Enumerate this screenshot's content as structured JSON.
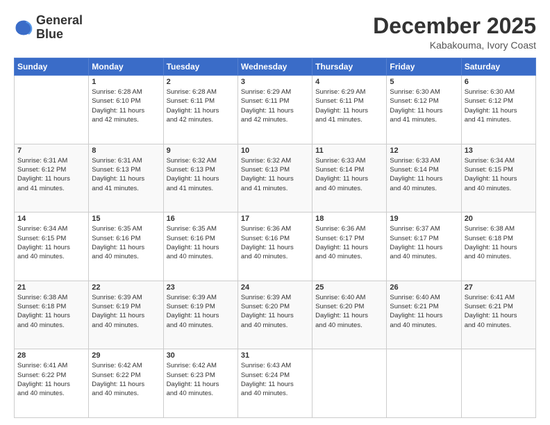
{
  "logo": {
    "line1": "General",
    "line2": "Blue"
  },
  "title": "December 2025",
  "location": "Kabakouma, Ivory Coast",
  "weekdays": [
    "Sunday",
    "Monday",
    "Tuesday",
    "Wednesday",
    "Thursday",
    "Friday",
    "Saturday"
  ],
  "weeks": [
    [
      {
        "day": "",
        "info": ""
      },
      {
        "day": "1",
        "info": "Sunrise: 6:28 AM\nSunset: 6:10 PM\nDaylight: 11 hours\nand 42 minutes."
      },
      {
        "day": "2",
        "info": "Sunrise: 6:28 AM\nSunset: 6:11 PM\nDaylight: 11 hours\nand 42 minutes."
      },
      {
        "day": "3",
        "info": "Sunrise: 6:29 AM\nSunset: 6:11 PM\nDaylight: 11 hours\nand 42 minutes."
      },
      {
        "day": "4",
        "info": "Sunrise: 6:29 AM\nSunset: 6:11 PM\nDaylight: 11 hours\nand 41 minutes."
      },
      {
        "day": "5",
        "info": "Sunrise: 6:30 AM\nSunset: 6:12 PM\nDaylight: 11 hours\nand 41 minutes."
      },
      {
        "day": "6",
        "info": "Sunrise: 6:30 AM\nSunset: 6:12 PM\nDaylight: 11 hours\nand 41 minutes."
      }
    ],
    [
      {
        "day": "7",
        "info": "Sunrise: 6:31 AM\nSunset: 6:12 PM\nDaylight: 11 hours\nand 41 minutes."
      },
      {
        "day": "8",
        "info": "Sunrise: 6:31 AM\nSunset: 6:13 PM\nDaylight: 11 hours\nand 41 minutes."
      },
      {
        "day": "9",
        "info": "Sunrise: 6:32 AM\nSunset: 6:13 PM\nDaylight: 11 hours\nand 41 minutes."
      },
      {
        "day": "10",
        "info": "Sunrise: 6:32 AM\nSunset: 6:13 PM\nDaylight: 11 hours\nand 41 minutes."
      },
      {
        "day": "11",
        "info": "Sunrise: 6:33 AM\nSunset: 6:14 PM\nDaylight: 11 hours\nand 40 minutes."
      },
      {
        "day": "12",
        "info": "Sunrise: 6:33 AM\nSunset: 6:14 PM\nDaylight: 11 hours\nand 40 minutes."
      },
      {
        "day": "13",
        "info": "Sunrise: 6:34 AM\nSunset: 6:15 PM\nDaylight: 11 hours\nand 40 minutes."
      }
    ],
    [
      {
        "day": "14",
        "info": "Sunrise: 6:34 AM\nSunset: 6:15 PM\nDaylight: 11 hours\nand 40 minutes."
      },
      {
        "day": "15",
        "info": "Sunrise: 6:35 AM\nSunset: 6:16 PM\nDaylight: 11 hours\nand 40 minutes."
      },
      {
        "day": "16",
        "info": "Sunrise: 6:35 AM\nSunset: 6:16 PM\nDaylight: 11 hours\nand 40 minutes."
      },
      {
        "day": "17",
        "info": "Sunrise: 6:36 AM\nSunset: 6:16 PM\nDaylight: 11 hours\nand 40 minutes."
      },
      {
        "day": "18",
        "info": "Sunrise: 6:36 AM\nSunset: 6:17 PM\nDaylight: 11 hours\nand 40 minutes."
      },
      {
        "day": "19",
        "info": "Sunrise: 6:37 AM\nSunset: 6:17 PM\nDaylight: 11 hours\nand 40 minutes."
      },
      {
        "day": "20",
        "info": "Sunrise: 6:38 AM\nSunset: 6:18 PM\nDaylight: 11 hours\nand 40 minutes."
      }
    ],
    [
      {
        "day": "21",
        "info": "Sunrise: 6:38 AM\nSunset: 6:18 PM\nDaylight: 11 hours\nand 40 minutes."
      },
      {
        "day": "22",
        "info": "Sunrise: 6:39 AM\nSunset: 6:19 PM\nDaylight: 11 hours\nand 40 minutes."
      },
      {
        "day": "23",
        "info": "Sunrise: 6:39 AM\nSunset: 6:19 PM\nDaylight: 11 hours\nand 40 minutes."
      },
      {
        "day": "24",
        "info": "Sunrise: 6:39 AM\nSunset: 6:20 PM\nDaylight: 11 hours\nand 40 minutes."
      },
      {
        "day": "25",
        "info": "Sunrise: 6:40 AM\nSunset: 6:20 PM\nDaylight: 11 hours\nand 40 minutes."
      },
      {
        "day": "26",
        "info": "Sunrise: 6:40 AM\nSunset: 6:21 PM\nDaylight: 11 hours\nand 40 minutes."
      },
      {
        "day": "27",
        "info": "Sunrise: 6:41 AM\nSunset: 6:21 PM\nDaylight: 11 hours\nand 40 minutes."
      }
    ],
    [
      {
        "day": "28",
        "info": "Sunrise: 6:41 AM\nSunset: 6:22 PM\nDaylight: 11 hours\nand 40 minutes."
      },
      {
        "day": "29",
        "info": "Sunrise: 6:42 AM\nSunset: 6:22 PM\nDaylight: 11 hours\nand 40 minutes."
      },
      {
        "day": "30",
        "info": "Sunrise: 6:42 AM\nSunset: 6:23 PM\nDaylight: 11 hours\nand 40 minutes."
      },
      {
        "day": "31",
        "info": "Sunrise: 6:43 AM\nSunset: 6:24 PM\nDaylight: 11 hours\nand 40 minutes."
      },
      {
        "day": "",
        "info": ""
      },
      {
        "day": "",
        "info": ""
      },
      {
        "day": "",
        "info": ""
      }
    ]
  ]
}
